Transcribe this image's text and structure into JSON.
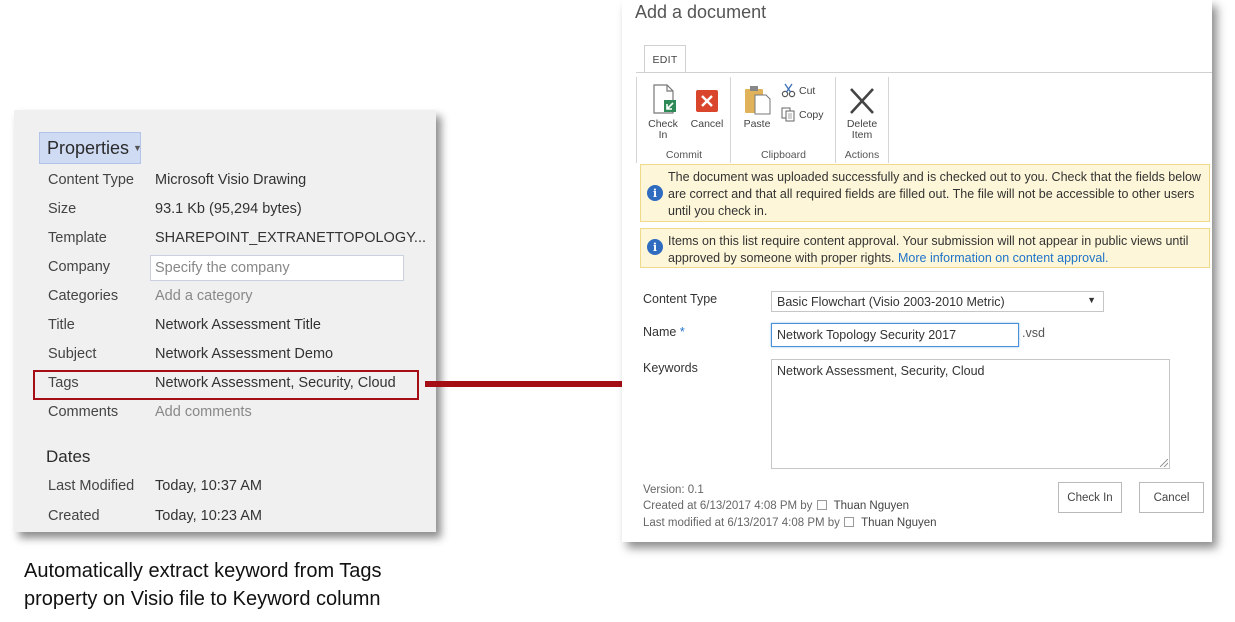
{
  "properties": {
    "header": "Properties",
    "rows": [
      {
        "key": "Content Type",
        "value": "Microsoft Visio Drawing"
      },
      {
        "key": "Size",
        "value": "93.1 Kb (95,294 bytes)"
      },
      {
        "key": "Template",
        "value": "SHAREPOINT_EXTRANETTOPOLOGY..."
      },
      {
        "key": "Company",
        "placeholder": "Specify the company"
      },
      {
        "key": "Categories",
        "placeholder": "Add a category"
      },
      {
        "key": "Title",
        "value": "Network Assessment Title"
      },
      {
        "key": "Subject",
        "value": "Network Assessment Demo"
      },
      {
        "key": "Tags",
        "value": "Network Assessment, Security, Cloud"
      },
      {
        "key": "Comments",
        "placeholder": "Add comments"
      }
    ],
    "dates_header": "Dates",
    "dates": [
      {
        "key": "Last Modified",
        "value": "Today, 10:37 AM"
      },
      {
        "key": "Created",
        "value": "Today, 10:23 AM"
      }
    ]
  },
  "caption": {
    "line1": "Automatically extract keyword from Tags",
    "line2": "property on Visio file to Keyword column"
  },
  "dialog": {
    "title": "Add a document",
    "tab": "EDIT",
    "ribbon": {
      "commit": {
        "label": "Commit",
        "check_in": [
          "Check",
          "In"
        ],
        "cancel": "Cancel"
      },
      "clipboard": {
        "label": "Clipboard",
        "paste": "Paste",
        "cut": "Cut",
        "copy": "Copy"
      },
      "actions": {
        "label": "Actions",
        "delete_item": [
          "Delete",
          "Item"
        ]
      }
    },
    "notices": [
      {
        "text": "The document was uploaded successfully and is checked out to you. Check that the fields below are correct and that all required fields are filled out. The file will not be accessible to other users until you check in."
      },
      {
        "text": "Items on this list require content approval. Your submission will not appear in public views until approved by someone with proper rights.",
        "link": "More information on content approval."
      }
    ],
    "fields": {
      "content_type": {
        "label": "Content Type",
        "value": "Basic Flowchart (Visio 2003-2010 Metric)"
      },
      "name": {
        "label": "Name",
        "required_mark": "*",
        "value": "Network Topology Security 2017",
        "extension": ".vsd"
      },
      "keywords": {
        "label": "Keywords",
        "value": "Network Assessment, Security, Cloud"
      }
    },
    "meta": {
      "version": "Version: 0.1",
      "created": "Created at 6/13/2017 4:08 PM  by",
      "modified": "Last modified at 6/13/2017 4:08 PM  by",
      "user": "Thuan Nguyen"
    },
    "buttons": {
      "check_in": "Check In",
      "cancel": "Cancel"
    }
  },
  "colors": {
    "accent": "#a50e15",
    "link": "#1f73c9",
    "notice_bg": "#fdf6d8",
    "header_bg": "#cfdaf3"
  }
}
